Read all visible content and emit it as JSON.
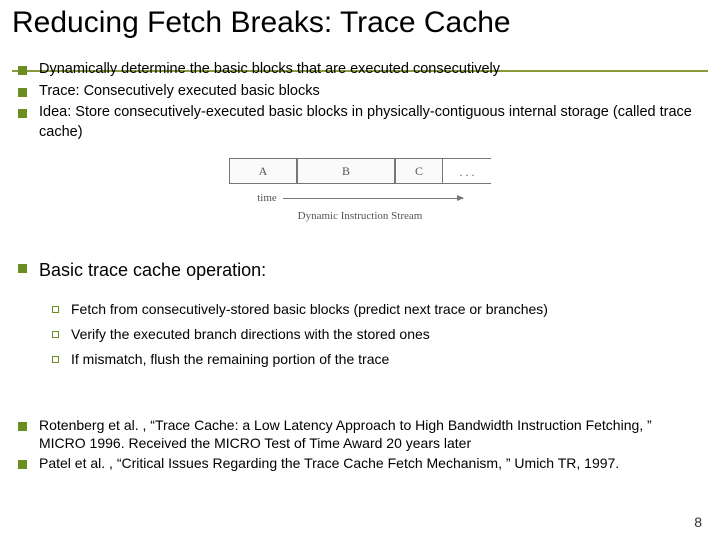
{
  "title": "Reducing Fetch Breaks: Trace Cache",
  "bullets_top": [
    "Dynamically determine the basic blocks that are executed consecutively",
    "Trace: Consecutively executed basic blocks",
    "Idea: Store consecutively-executed basic blocks in physically-contiguous internal storage (called trace cache)"
  ],
  "diagram": {
    "blocks": [
      "A",
      "B",
      "C",
      ". . ."
    ],
    "arrow_label": "time",
    "caption": "Dynamic Instruction Stream"
  },
  "heading_mid": "Basic trace cache operation:",
  "sub_bullets": [
    "Fetch from consecutively-stored basic blocks (predict next trace or branches)",
    "Verify the executed branch directions with the stored ones",
    "If mismatch, flush the remaining portion of the trace"
  ],
  "refs": [
    "Rotenberg et al. , “Trace Cache: a Low Latency Approach to High Bandwidth Instruction Fetching, ” MICRO 1996.   Received the MICRO Test of Time Award 20 years later",
    "Patel et al. , “Critical Issues Regarding the Trace Cache Fetch Mechanism, ” Umich TR, 1997."
  ],
  "page_number": "8"
}
